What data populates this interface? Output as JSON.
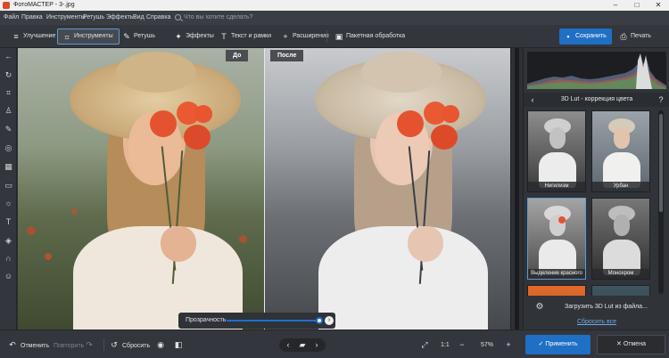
{
  "window": {
    "title": "ФотоМАСТЕР - 3-.jpg",
    "minimize": "–",
    "maximize": "□",
    "close": "✕"
  },
  "menu": {
    "items": [
      "Файл",
      "Правка",
      "Инструменты",
      "Ретушь",
      "Эффекты",
      "Вид",
      "Справка"
    ],
    "search_placeholder": "Что вы хотите сделать?"
  },
  "toolbar": {
    "tabs": [
      {
        "label": "Улучшение",
        "icon": "sliders-icon"
      },
      {
        "label": "Инструменты",
        "icon": "crop-icon",
        "active": true
      },
      {
        "label": "Ретушь",
        "icon": "brush-icon"
      },
      {
        "label": "Эффекты",
        "icon": "magic-wand-icon"
      },
      {
        "label": "Текст и рамки",
        "icon": "text-icon"
      },
      {
        "label": "Расширения",
        "icon": "plus-icon"
      },
      {
        "label": "Пакетная обработка",
        "icon": "batch-icon"
      }
    ],
    "save_label": "Сохранить",
    "print_label": "Печать"
  },
  "compare": {
    "before_label": "До",
    "after_label": "После"
  },
  "opacity": {
    "label": "Прозрачность",
    "value_percent": 100
  },
  "panel": {
    "title": "3D Lut - коррекция цвета",
    "back_icon": "arrow-left-icon",
    "help_icon": "question-icon",
    "luts": [
      {
        "name": "Нигилизм",
        "style": "bw-contrast"
      },
      {
        "name": "Урбан",
        "style": "cool-faded"
      },
      {
        "name": "Выделение красного",
        "style": "selective-red"
      },
      {
        "name": "Монохром",
        "style": "monochrome"
      },
      {
        "name": "",
        "style": "warm-orange"
      },
      {
        "name": "",
        "style": "dark-teal"
      }
    ],
    "load_label": "Загрузить 3D Lut из файла...",
    "reset_all_label": "Сбросить все"
  },
  "bottom": {
    "undo_label": "Отменить",
    "redo_label": "Повторить",
    "reset_label": "Сбросить",
    "zoom_ratio_label": "1:1",
    "zoom_percent": "57%",
    "apply_label": "Применить",
    "cancel_label": "Отмена"
  },
  "colors": {
    "accent": "#1f6fc5",
    "link": "#6aa9ea",
    "panel_bg": "#303338",
    "toolbar_bg": "#33363c"
  }
}
